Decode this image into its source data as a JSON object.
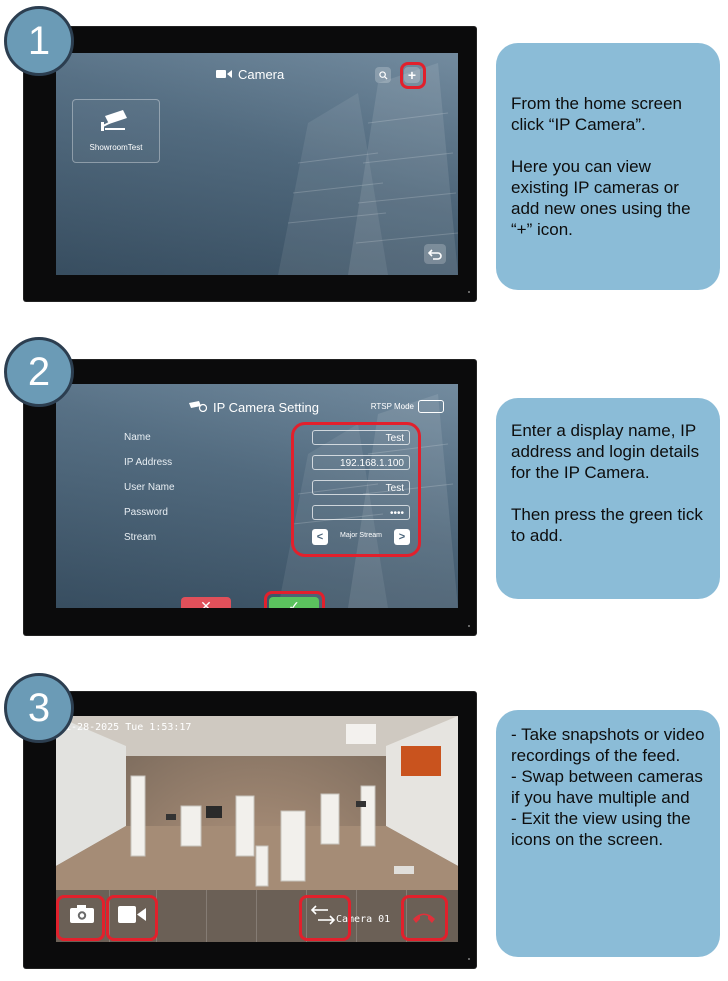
{
  "steps": [
    {
      "number": "1",
      "callout": "From the home screen click “IP Camera”.\n\nHere you can view existing IP cameras or add new ones using the “+” icon.",
      "screen": {
        "title": "Camera",
        "tile_label": "ShowroomTest",
        "search_icon": "search-icon",
        "add_label": "+",
        "back_icon": "return-arrow-icon"
      }
    },
    {
      "number": "2",
      "callout": "Enter a display name, IP address and login details for the IP Camera.\n\nThen press the green tick to add.",
      "screen": {
        "title": "IP Camera Setting",
        "rtsp_label": "RTSP Mode",
        "fields": [
          {
            "label": "Name",
            "value": "Test"
          },
          {
            "label": "IP Address",
            "value": "192.168.1.100"
          },
          {
            "label": "User Name",
            "value": "Test"
          },
          {
            "label": "Password",
            "value": "••••"
          },
          {
            "label": "Stream",
            "value": "Major Stream"
          }
        ],
        "cancel_label": "✕",
        "confirm_label": "✓"
      }
    },
    {
      "number": "3",
      "callout": "- Take snapshots or video recordings of the feed.\n- Swap between cameras if you have multiple and\n- Exit the view using the icons on the screen.",
      "screen": {
        "timestamp": "01-28-2025 Tue 1:53:17",
        "camera_name": "Camera 01",
        "icons": [
          "camera-icon",
          "video-icon",
          "swap-icon",
          "hangup-icon"
        ]
      }
    }
  ],
  "colors": {
    "badge": "#6b9bb6",
    "callout": "#8bbcd7",
    "highlight": "#e2202c",
    "confirm": "#5bc25e",
    "cancel": "#e0505a"
  }
}
